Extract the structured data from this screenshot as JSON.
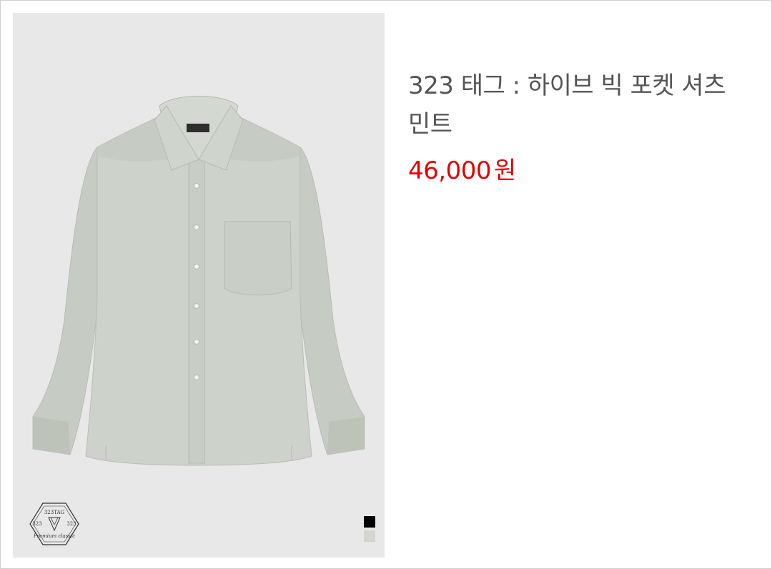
{
  "product": {
    "title": "323 태그 : 하이브 빅 포켓 셔츠 민트",
    "price": "46,000",
    "currency": "원",
    "image_alt": "mint long sleeve shirt",
    "collar_label": "323TAG"
  },
  "brand_badge": {
    "name": "323TAG",
    "tagline": "Premium classic",
    "left_mark": "323",
    "right_mark": "323"
  },
  "color_swatches": [
    {
      "name": "black",
      "color": "#000000"
    },
    {
      "name": "mint",
      "color": "#d2d6ce"
    }
  ],
  "colors": {
    "price": "#e60000",
    "title": "#555555",
    "image_background": "#e8e8e8"
  }
}
